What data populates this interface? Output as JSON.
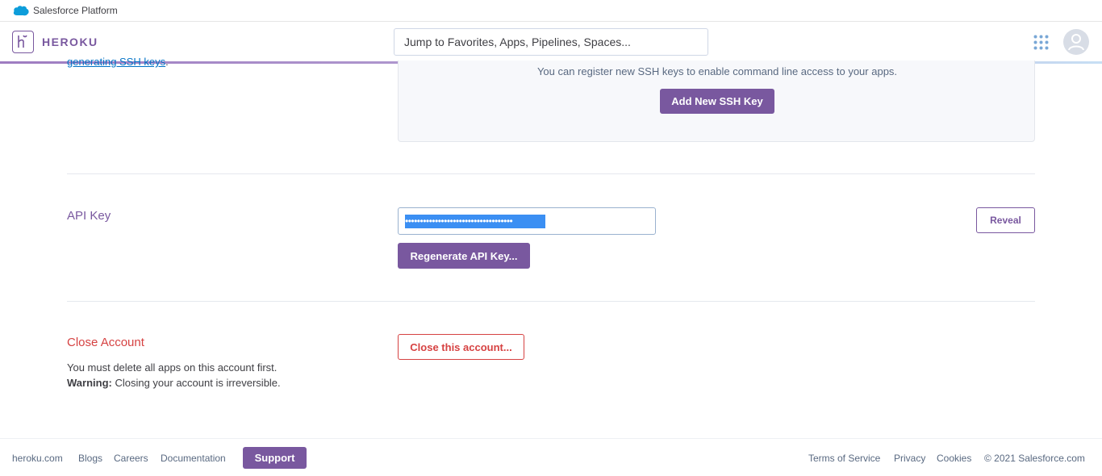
{
  "platform_bar": {
    "title": "Salesforce Platform"
  },
  "header": {
    "brand": "HEROKU",
    "search_placeholder": "Jump to Favorites, Apps, Pipelines, Spaces..."
  },
  "ssh": {
    "left_link": "generating SSH keys",
    "left_suffix": ".",
    "message": "You can register new SSH keys to enable command line access to your apps.",
    "add_button": "Add New SSH Key"
  },
  "api_key": {
    "title": "API Key",
    "masked_value": "••••••••••••••••••••••••••••••••••••",
    "reveal_button": "Reveal",
    "regenerate_button": "Regenerate API Key..."
  },
  "close_account": {
    "title": "Close Account",
    "line1": "You must delete all apps on this account first.",
    "warning_label": "Warning:",
    "warning_text": " Closing your account is irreversible.",
    "button": "Close this account..."
  },
  "footer": {
    "links_left": [
      "heroku.com",
      "Blogs",
      "Careers",
      "Documentation"
    ],
    "support": "Support",
    "links_right": [
      "Terms of Service",
      "Privacy",
      "Cookies",
      "© 2021 Salesforce.com"
    ]
  },
  "colors": {
    "brand": "#79589f",
    "danger": "#d64242",
    "link": "#0072c6"
  }
}
